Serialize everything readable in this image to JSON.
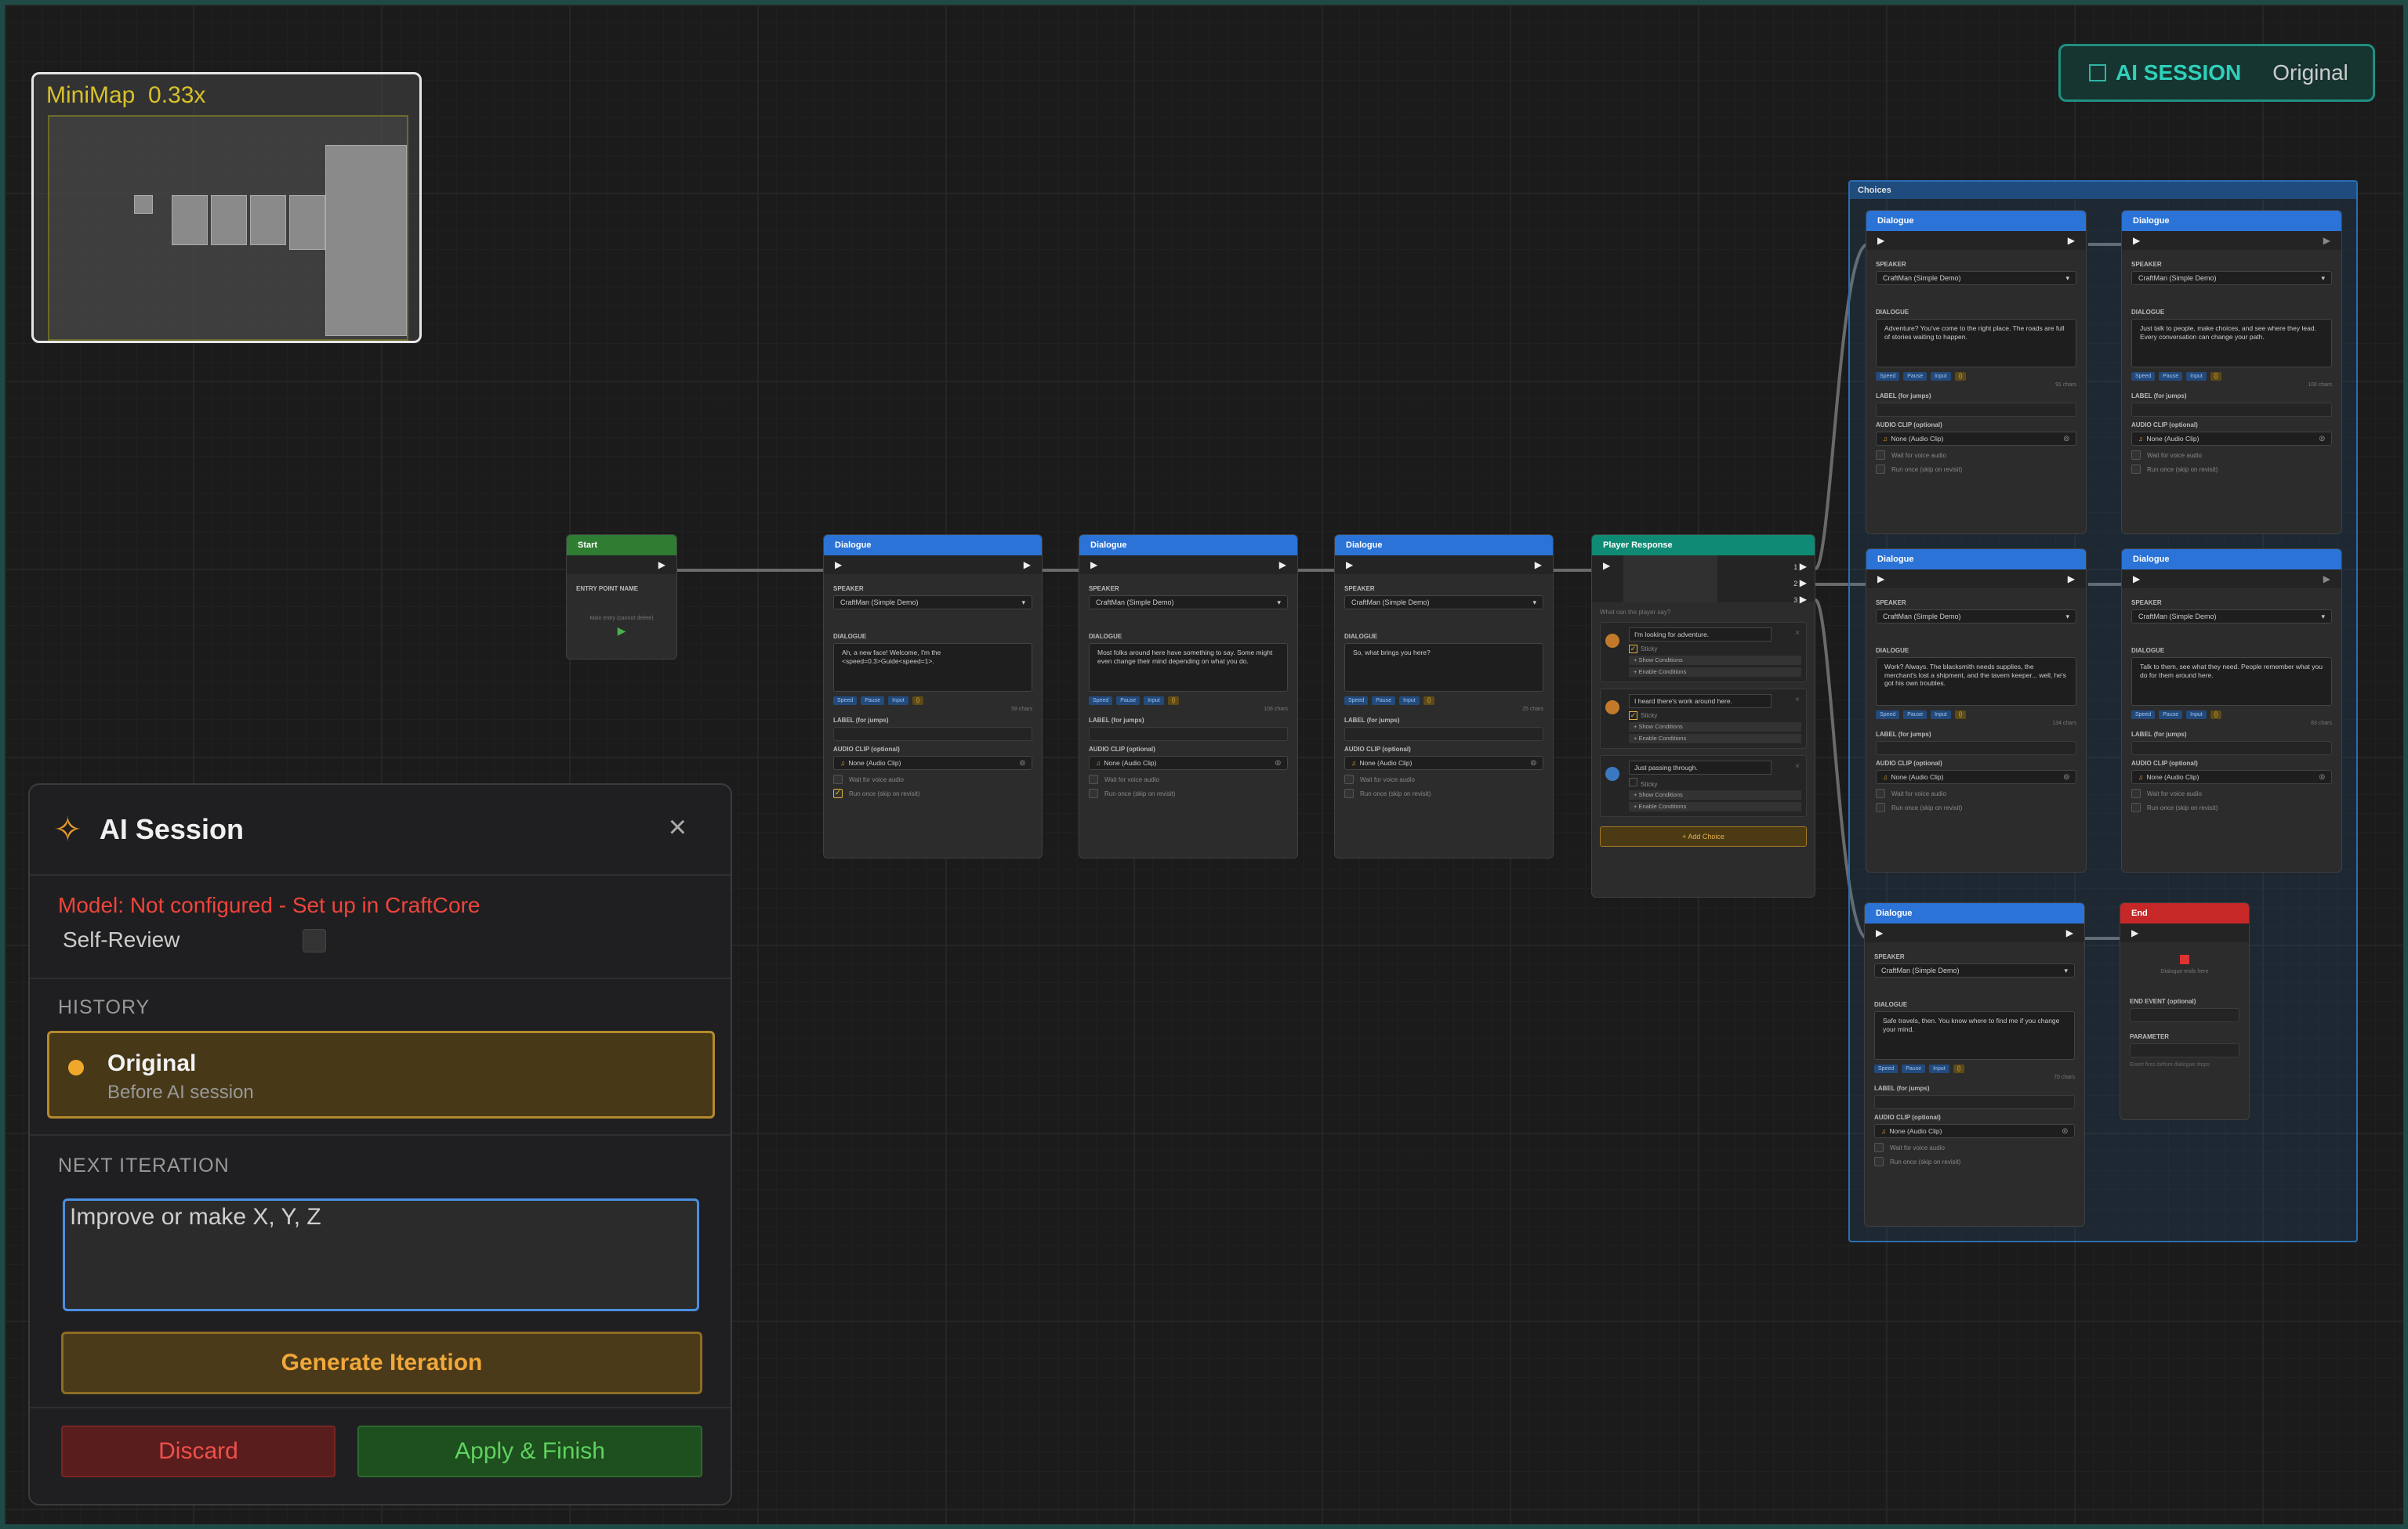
{
  "minimap": {
    "title": "MiniMap",
    "zoom": "0.33x"
  },
  "session_button": {
    "label": "AI SESSION",
    "mode": "Original"
  },
  "start_node": {
    "title": "Start",
    "entry_label": "ENTRY POINT NAME",
    "entry_placeholder": "Main entry (cannot delete)"
  },
  "labels": {
    "speaker": "SPEAKER",
    "dialogue": "DIALOGUE",
    "label": "LABEL (for jumps)",
    "audio": "AUDIO CLIP (optional)",
    "audio_value": "None (Audio Clip)",
    "wait": "Wait for voice audio",
    "run_once": "Run once (skip on revisit)",
    "chips": [
      "Speed",
      "Pause",
      "Input",
      "{}"
    ],
    "speaker_value": "CraftMan (Simple Demo)",
    "dialogue_title": "Dialogue"
  },
  "dialogue_nodes": [
    {
      "text": "Ah, a new face! Welcome, I'm the <speed=0.3>Guide<speed=1>.",
      "chars": "58 chars",
      "run_once": true
    },
    {
      "text": "Most folks around here have something to say. Some might even change their mind depending on what you do.",
      "chars": "106 chars",
      "run_once": false
    },
    {
      "text": "So, what brings you here?",
      "chars": "25 chars",
      "run_once": false
    }
  ],
  "player_response": {
    "title": "Player Response",
    "ports": [
      "1",
      "2",
      "3"
    ],
    "prompt_placeholder": "What can the player say?",
    "sticky": "Sticky",
    "show_conditions": "+ Show Conditions",
    "enable_conditions": "+ Enable Conditions",
    "choices": [
      {
        "text": "I'm looking for adventure.",
        "sticky": true,
        "color": "#c27a2a"
      },
      {
        "text": "I heard there's work around here.",
        "sticky": true,
        "color": "#c27a2a"
      },
      {
        "text": "Just passing through.",
        "sticky": false,
        "color": "#3a78c0"
      }
    ],
    "add_choice": "+ Add Choice"
  },
  "group": {
    "title": "Choices"
  },
  "group_nodes": [
    {
      "text": "Adventure? You've come to the right place. The roads are full of stories waiting to happen.",
      "chars": "91 chars"
    },
    {
      "text": "Just talk to people, make choices, and see where they lead. Every conversation can change your path.",
      "chars": "100 chars"
    },
    {
      "text": "Work? Always. The blacksmith needs supplies, the merchant's lost a shipment, and the tavern keeper... well, he's got his own troubles.",
      "chars": "134 chars"
    },
    {
      "text": "Talk to them, see what they need. People remember what you do for them around here.",
      "chars": "83 chars"
    },
    {
      "text": "Safe travels, then. You know where to find me if you change your mind.",
      "chars": "70 chars"
    }
  ],
  "end_node": {
    "title": "End",
    "text": "Dialogue ends here",
    "event_label": "END EVENT (optional)",
    "param_label": "PARAMETER",
    "hint": "Event fires before dialogue stops"
  },
  "ai_panel": {
    "title": "AI Session",
    "model_status": "Model: Not configured - Set up in CraftCore",
    "self_review": "Self-Review",
    "history_label": "HISTORY",
    "history": [
      {
        "name": "Original",
        "desc": "Before AI session"
      }
    ],
    "next_label": "NEXT ITERATION",
    "prompt_value": "Improve or make X, Y, Z",
    "generate": "Generate Iteration",
    "discard": "Discard",
    "apply": "Apply & Finish"
  }
}
